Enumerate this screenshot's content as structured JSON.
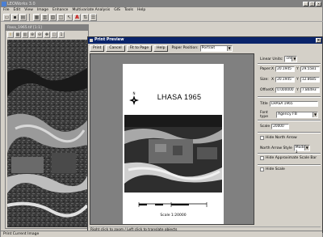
{
  "app": {
    "title": "LEOWorks 3.0",
    "menu": [
      "File",
      "Edit",
      "View",
      "Image",
      "Enhance",
      "Multivariate Analysis",
      "GIS",
      "Tools",
      "Help"
    ],
    "status": "Print Current Image"
  },
  "image_window": {
    "title": "Rasa_1965.tif [1:1]"
  },
  "print_preview": {
    "title": "Print Preview",
    "toolbar": {
      "print": "Print",
      "cancel": "Cancel",
      "fit_to_page": "Fit to Page",
      "help": "Help",
      "paper_position_label": "Paper Position:",
      "paper_position_value": "Portrait"
    },
    "page": {
      "title": "LHASA 1965",
      "north_label": "N",
      "scale_text": "Scale 1:20000"
    },
    "panel": {
      "linear_units_label": "Linear Units:",
      "linear_units_value": "cm",
      "paper_label": "Paper:",
      "paper_x_label": "X",
      "paper_x": "20.1945",
      "paper_y_label": "Y",
      "paper_y": "29.5581",
      "size_label": "Size:",
      "size_x_label": "X",
      "size_x": "20.1945",
      "size_y_label": "Y",
      "size_y": "12.8685",
      "offset_label": "Offset:",
      "offset_x_label": "X",
      "offset_x": "0.000000",
      "offset_y_label": "Y",
      "offset_y": "7.84493",
      "title_label": "Title",
      "title_value": "LHASA 1965",
      "font_type_label": "Font type",
      "font_type_value": "Agency FB",
      "scale_label": "Scale",
      "scale_value": "20000",
      "hide_north_arrow": "Hide North Arrow",
      "north_arrow_style_label": "North Arrow Style",
      "north_arrow_style_value": "Model 1",
      "hide_scale_bar": "Hide Approximate Scale Bar",
      "hide_scale": "Hide Scale"
    },
    "status": "Right click to zoom / Left click to translate objects"
  }
}
